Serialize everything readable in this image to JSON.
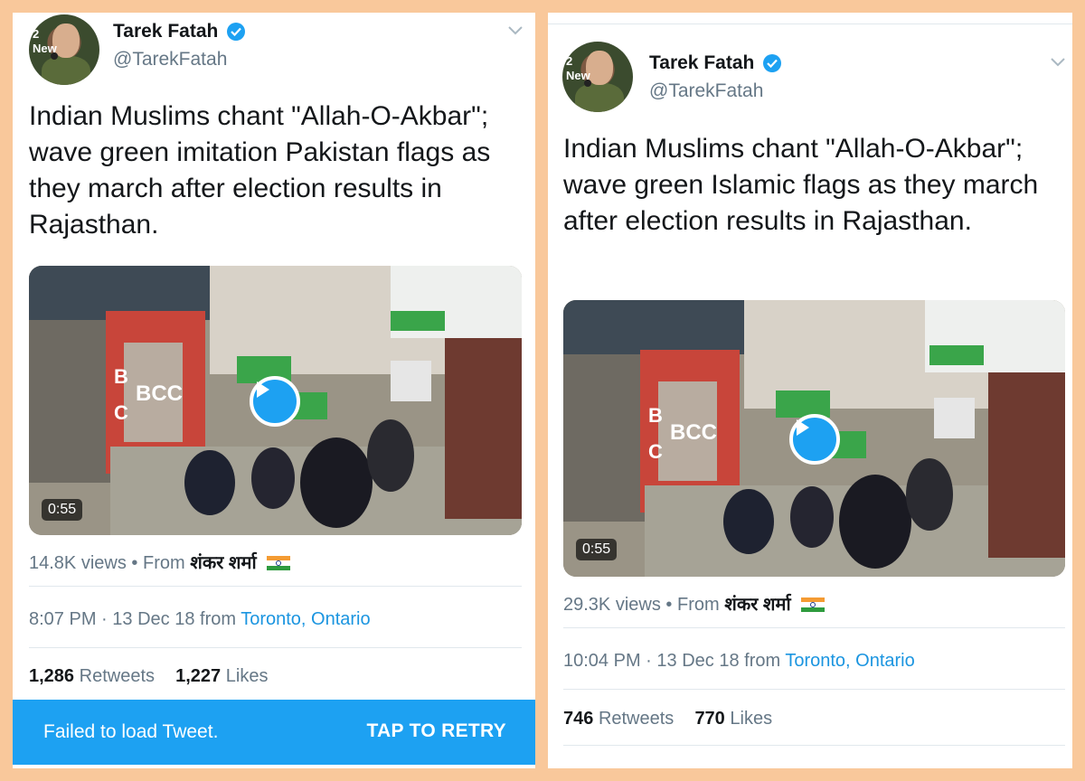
{
  "tweets": [
    {
      "author_name": "Tarek Fatah",
      "handle": "@TarekFatah",
      "avatar_text": "2\nNew",
      "text": "Indian Muslims chant \"Allah-O-Akbar\"; wave green imitation Pakistan flags as they march after election results in Rajasthan.",
      "video": {
        "duration": "0:55",
        "shop_sign_1": "BCC",
        "shop_sign_2": "B",
        "shop_sign_3": "C"
      },
      "views": "14.8K views",
      "from_label": "From",
      "from_user": "शंकर शर्मा",
      "time": "8:07 PM",
      "date": "13 Dec 18",
      "from_location_label": "from",
      "location": "Toronto, Ontario",
      "retweets_count": "1,286",
      "retweets_label": "Retweets",
      "likes_count": "1,227",
      "likes_label": "Likes",
      "error_message": "Failed to load Tweet.",
      "retry_label": "TAP TO RETRY"
    },
    {
      "author_name": "Tarek Fatah",
      "handle": "@TarekFatah",
      "avatar_text": "2\nNew",
      "text": "Indian Muslims chant \"Allah-O-Akbar\"; wave green Islamic flags as they march after election results in Rajasthan.",
      "video": {
        "duration": "0:55",
        "shop_sign_1": "BCC",
        "shop_sign_2": "B",
        "shop_sign_3": "C"
      },
      "views": "29.3K views",
      "from_label": "From",
      "from_user": "शंकर शर्मा",
      "time": "10:04 PM",
      "date": "13 Dec 18",
      "from_location_label": "from",
      "location": "Toronto, Ontario",
      "retweets_count": "746",
      "retweets_label": "Retweets",
      "likes_count": "770",
      "likes_label": "Likes"
    }
  ],
  "separator": "·",
  "bullet": "•",
  "colors": {
    "background": "#f9c89b",
    "accent": "#1da1f2",
    "link": "#1b95e0",
    "muted": "#657786"
  },
  "icons": [
    "verified-badge-icon",
    "chevron-down-icon",
    "play-icon",
    "india-flag-icon"
  ]
}
